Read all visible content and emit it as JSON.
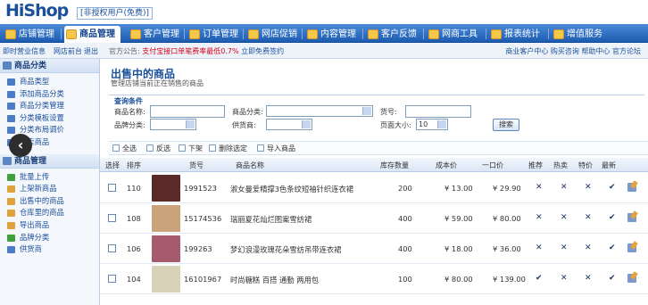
{
  "app": {
    "logo": "HiShop",
    "user_badge": "[非授权用户(免费)]"
  },
  "nav": {
    "items": [
      {
        "label": "店铺管理",
        "active": false
      },
      {
        "label": "商品管理",
        "active": true
      },
      {
        "label": "客户管理",
        "active": false
      },
      {
        "label": "订单管理",
        "active": false
      },
      {
        "label": "网店促销",
        "active": false
      },
      {
        "label": "内容管理",
        "active": false
      },
      {
        "label": "客户反馈",
        "active": false
      },
      {
        "label": "网商工具",
        "active": false
      },
      {
        "label": "报表统计",
        "active": false
      },
      {
        "label": "增值服务",
        "active": false
      }
    ]
  },
  "subbar": {
    "left_links": [
      "即时营业信息",
      "网店前台",
      "退出"
    ],
    "announce_label": "官方公告:",
    "announce_text": "支付宝接口单笔费率最低0.7%",
    "announce_link": "立即免费签约",
    "right_links": "商业客户中心  购买咨询  帮助中心  官方论坛"
  },
  "sidebar": {
    "section1": {
      "title": "商品分类",
      "items": [
        "商品类型",
        "添加商品分类",
        "商品分类管理",
        "分类模板设置",
        "分类布局调价",
        "热卖商品"
      ]
    },
    "section2": {
      "title": "商品管理",
      "items": [
        "批量上传",
        "上架新商品",
        "出售中的商品",
        "仓库里的商品",
        "导出商品",
        "品牌分类",
        "供货商"
      ]
    }
  },
  "main": {
    "title": "出售中的商品",
    "subtitle": "管理店铺当前正在销售的商品",
    "search": {
      "title": "查询条件",
      "name_label": "商品名称:",
      "category_label": "商品分类:",
      "sku_label": "货号:",
      "brand_label": "品牌分类:",
      "supplier_label": "供货商:",
      "pagesize_label": "页面大小:",
      "pagesize_value": "10",
      "search_button": "搜索"
    },
    "toolbar": [
      "全选",
      "反选",
      "下架",
      "删除选定",
      "导入商品"
    ],
    "columns": [
      "选择",
      "排序",
      "货号",
      "商品名称",
      "库存数量",
      "成本价",
      "一口价",
      "推荐",
      "热卖",
      "特价",
      "最新"
    ],
    "rows": [
      {
        "sort": "110",
        "sku": "1991523",
        "name": "淑女曼爱精撑3色条纹短袖针织连衣裙",
        "stock": "200",
        "cost": "¥ 13.00",
        "price": "¥ 29.90",
        "flags": [
          "x",
          "x",
          "x",
          "v"
        ],
        "thumb_color": "#5a2a2a"
      },
      {
        "sort": "108",
        "sku": "15174536",
        "name": "瑞丽夏花灿烂图案雪纺裙",
        "stock": "400",
        "cost": "¥ 59.00",
        "price": "¥ 80.00",
        "flags": [
          "x",
          "x",
          "x",
          "v"
        ],
        "thumb_color": "#c9a37a"
      },
      {
        "sort": "106",
        "sku": "199263",
        "name": "梦幻浪漫玫瑰花朵雪纺吊带连衣裙",
        "stock": "400",
        "cost": "¥ 18.00",
        "price": "¥ 36.00",
        "flags": [
          "x",
          "x",
          "x",
          "v"
        ],
        "thumb_color": "#a65a6e"
      },
      {
        "sort": "104",
        "sku": "16101967",
        "name": "时尚糖糕  百搭  通勤  两用包",
        "stock": "100",
        "cost": "¥ 80.00",
        "price": "¥ 139.00",
        "flags": [
          "v",
          "x",
          "x",
          "v"
        ],
        "thumb_color": "#d8d2b8"
      }
    ]
  },
  "colors": {
    "nav_blue": "#1d5cb0",
    "link_blue": "#1a4f9a",
    "announce_red": "#d0021b"
  }
}
